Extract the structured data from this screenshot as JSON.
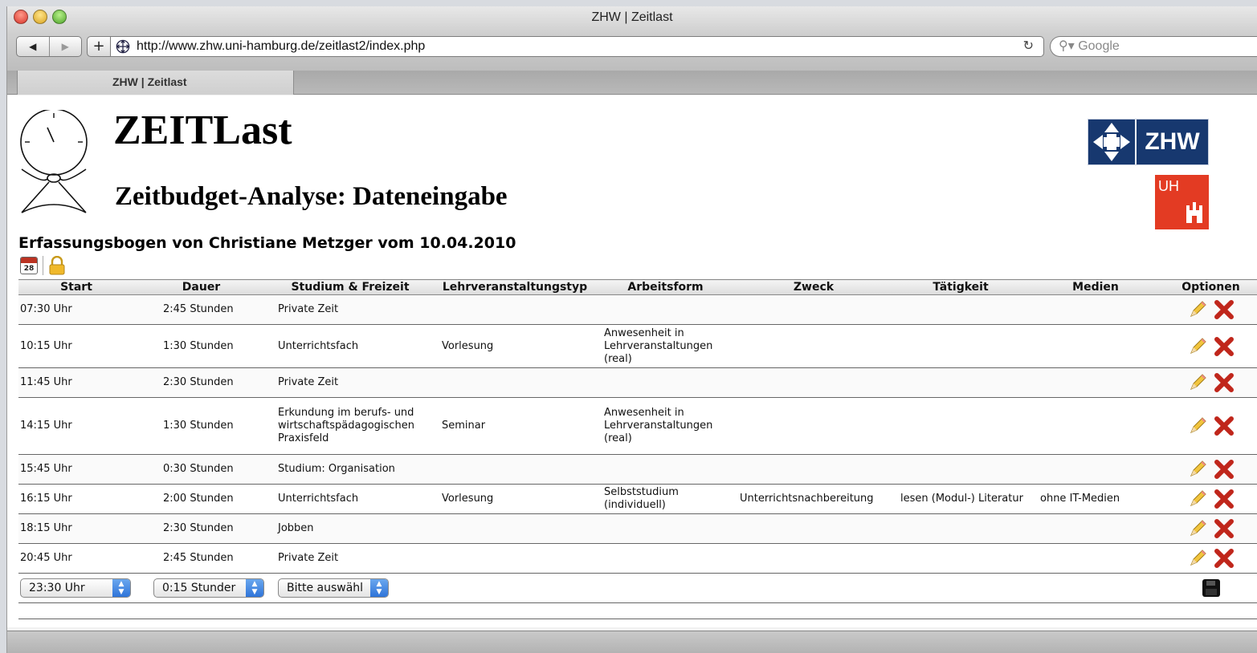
{
  "window": {
    "title": "ZHW | Zeitlast",
    "url": "http://www.zhw.uni-hamburg.de/zeitlast2/index.php",
    "search_placeholder": "Google",
    "tab_label": "ZHW | Zeitlast"
  },
  "header": {
    "app_title": "ZEITLast",
    "subtitle": "Zeitbudget-Analyse: Dateneingabe",
    "zhw_logo_text": "ZHW",
    "uhh_logo_text": "UH"
  },
  "form": {
    "heading": "Erfassungsbogen von Christiane Metzger vom 10.04.2010",
    "calendar_day": "28"
  },
  "table": {
    "columns": [
      "Start",
      "Dauer",
      "Studium & Freizeit",
      "Lehrveranstaltungstyp",
      "Arbeitsform",
      "Zweck",
      "Tätigkeit",
      "Medien",
      "Optionen"
    ],
    "rows": [
      {
        "start": "07:30 Uhr",
        "dauer": "2:45 Stunden",
        "studium": "Private Zeit",
        "lv_typ": "",
        "arbeitsform": "",
        "zweck": "",
        "taetigkeit": "",
        "medien": ""
      },
      {
        "start": "10:15 Uhr",
        "dauer": "1:30 Stunden",
        "studium": "Unterrichtsfach",
        "lv_typ": "Vorlesung",
        "arbeitsform": "Anwesenheit in Lehrveranstaltungen (real)",
        "zweck": "",
        "taetigkeit": "",
        "medien": ""
      },
      {
        "start": "11:45 Uhr",
        "dauer": "2:30 Stunden",
        "studium": "Private Zeit",
        "lv_typ": "",
        "arbeitsform": "",
        "zweck": "",
        "taetigkeit": "",
        "medien": ""
      },
      {
        "start": "14:15 Uhr",
        "dauer": "1:30 Stunden",
        "studium": "Erkundung im berufs- und wirtschaftspädagogischen Praxisfeld",
        "lv_typ": "Seminar",
        "arbeitsform": "Anwesenheit in Lehrveranstaltungen (real)",
        "zweck": "",
        "taetigkeit": "",
        "medien": ""
      },
      {
        "start": "15:45 Uhr",
        "dauer": "0:30 Stunden",
        "studium": "Studium: Organisation",
        "lv_typ": "",
        "arbeitsform": "",
        "zweck": "",
        "taetigkeit": "",
        "medien": ""
      },
      {
        "start": "16:15 Uhr",
        "dauer": "2:00 Stunden",
        "studium": "Unterrichtsfach",
        "lv_typ": "Vorlesung",
        "arbeitsform": "Selbststudium (individuell)",
        "zweck": "Unterrichtsnachbereitung",
        "taetigkeit": "lesen (Modul-) Literatur",
        "medien": "ohne IT-Medien"
      },
      {
        "start": "18:15 Uhr",
        "dauer": "2:30 Stunden",
        "studium": "Jobben",
        "lv_typ": "",
        "arbeitsform": "",
        "zweck": "",
        "taetigkeit": "",
        "medien": ""
      },
      {
        "start": "20:45 Uhr",
        "dauer": "2:45 Stunden",
        "studium": "Private Zeit",
        "lv_typ": "",
        "arbeitsform": "",
        "zweck": "",
        "taetigkeit": "",
        "medien": ""
      }
    ],
    "new_entry": {
      "start_value": "23:30 Uhr",
      "dauer_value": "0:15 Stunder",
      "studium_value": "Bitte auswähl"
    }
  },
  "colors": {
    "delete": "#c0261b",
    "zhw_blue": "#17386f",
    "uhh_red": "#e33b23",
    "scroll_blue": "#3e86ea"
  }
}
